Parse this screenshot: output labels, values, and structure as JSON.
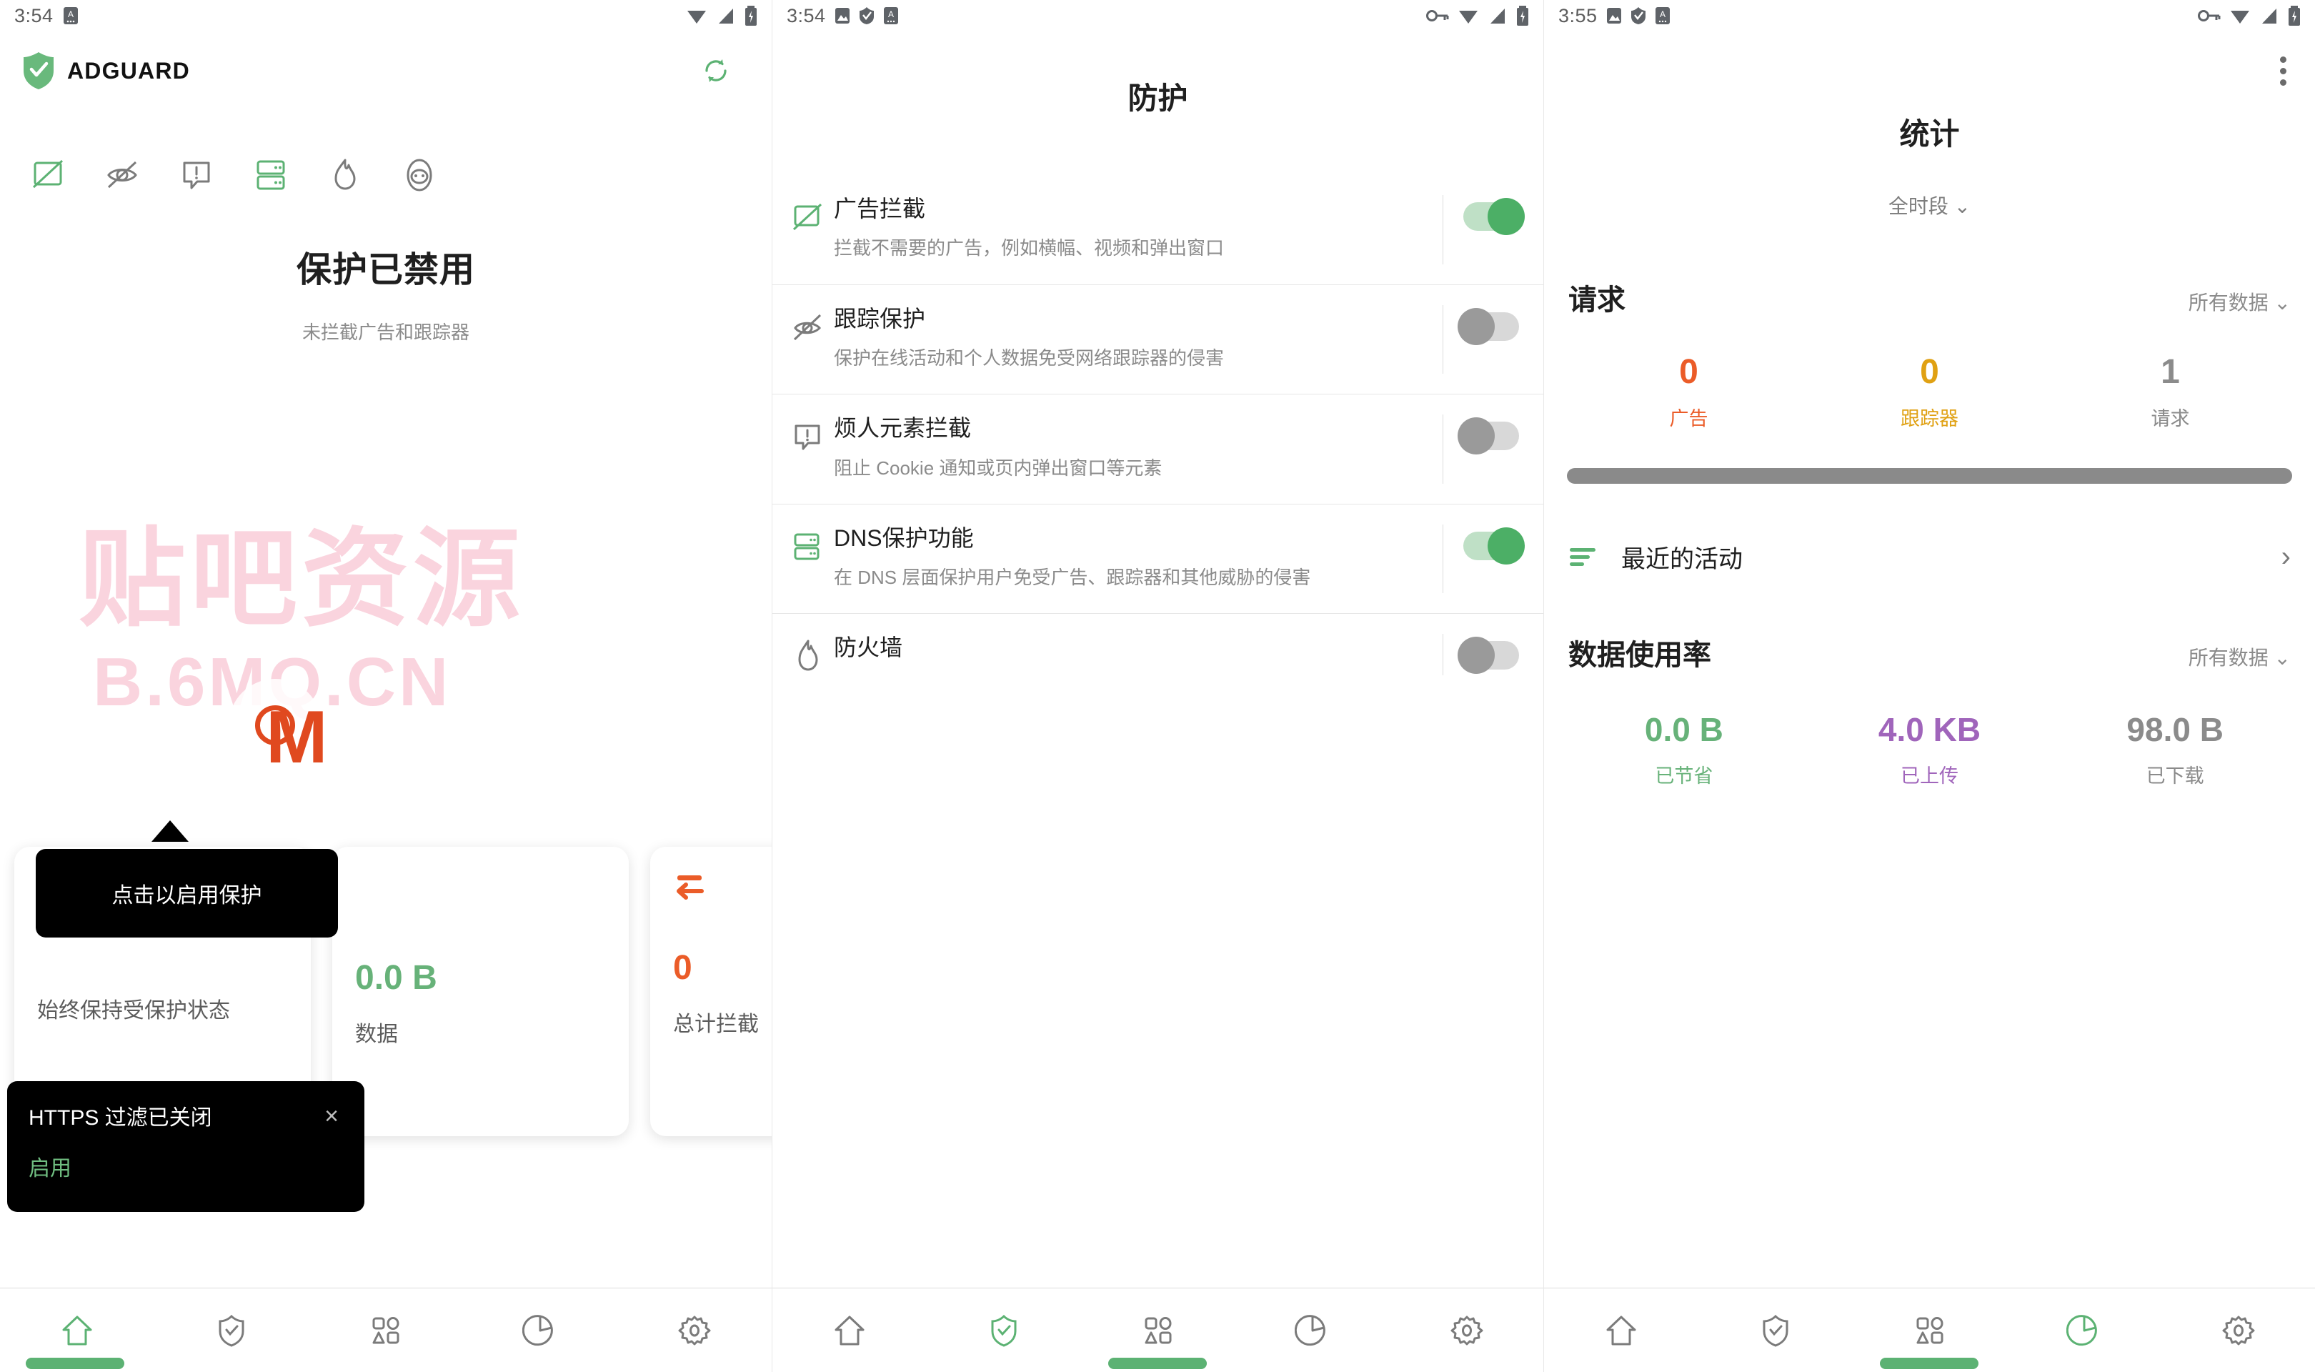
{
  "screens": [
    {
      "statusbar": {
        "time": "3:54",
        "icons": [
          "adguard-status-icon"
        ],
        "right_icons": [
          "wifi-icon",
          "signal-icon",
          "battery-charging-icon"
        ]
      },
      "appbar": {
        "brand": "ADGUARD",
        "refresh": "refresh-icon"
      },
      "protection": {
        "title": "保护已禁用",
        "subtitle": "未拦截广告和跟踪器",
        "icons": [
          "ad-blocking-icon",
          "tracking-protection-icon",
          "annoyance-icon",
          "dns-icon",
          "firewall-icon",
          "browsing-security-icon"
        ]
      },
      "watermark": {
        "line1": "贴吧资源",
        "line2": "B.6MQ.CN",
        "badge": "M"
      },
      "cards": [
        {
          "value": "",
          "label": "始终保持受保护状态"
        },
        {
          "value": "0.0 B",
          "label": "数据"
        },
        {
          "value": "0",
          "label": "总计拦截"
        }
      ],
      "tooltip": {
        "text": "点击以启用保护"
      },
      "snackbar": {
        "title": "HTTPS 过滤已关闭",
        "action": "启用",
        "close": "×"
      },
      "nav": [
        "home-icon",
        "shield-check-icon",
        "apps-icon",
        "pie-chart-icon",
        "gear-icon"
      ],
      "nav_active_index": 0
    },
    {
      "statusbar": {
        "time": "3:54",
        "right_icons": [
          "key-icon",
          "wifi-icon",
          "signal-icon",
          "battery-charging-icon"
        ]
      },
      "title": "防护",
      "items": [
        {
          "icon": "ad-blocking-icon",
          "name": "广告拦截",
          "desc": "拦截不需要的广告，例如横幅、视频和弹出窗口",
          "enabled": true
        },
        {
          "icon": "tracking-protection-icon",
          "name": "跟踪保护",
          "desc": "保护在线活动和个人数据免受网络跟踪器的侵害",
          "enabled": false
        },
        {
          "icon": "annoyance-icon",
          "name": "烦人元素拦截",
          "desc": "阻止 Cookie 通知或页内弹出窗口等元素",
          "enabled": false
        },
        {
          "icon": "dns-icon",
          "name": "DNS保护功能",
          "desc": "在 DNS 层面保护用户免受广告、跟踪器和其他威胁的侵害",
          "enabled": true
        },
        {
          "icon": "firewall-icon",
          "name": "防火墙",
          "desc": "",
          "enabled": false
        }
      ],
      "nav": [
        "home-icon",
        "shield-check-icon",
        "apps-icon",
        "pie-chart-icon",
        "gear-icon"
      ],
      "nav_active_index": 1
    },
    {
      "statusbar": {
        "time": "3:55",
        "right_icons": [
          "key-icon",
          "wifi-icon",
          "signal-icon",
          "battery-charging-icon"
        ]
      },
      "title": "统计",
      "period_filter": "全时段",
      "requests": {
        "heading": "请求",
        "filter": "所有数据",
        "stats": [
          {
            "value": "0",
            "label": "广告",
            "color": "#eb5c28"
          },
          {
            "value": "0",
            "label": "跟踪器",
            "color": "#e0a113"
          },
          {
            "value": "1",
            "label": "请求",
            "color": "#8b8b8b"
          }
        ]
      },
      "recent_activity": {
        "label": "最近的活动",
        "chevron": "›"
      },
      "usage": {
        "heading": "数据使用率",
        "filter": "所有数据",
        "stats": [
          {
            "value": "0.0 B",
            "label": "已节省",
            "color": "#67b279"
          },
          {
            "value": "4.0 KB",
            "label": "已上传",
            "color": "#a065bb"
          },
          {
            "value": "98.0 B",
            "label": "已下载",
            "color": "#8b8b8b"
          }
        ]
      },
      "nav": [
        "home-icon",
        "shield-check-icon",
        "apps-icon",
        "pie-chart-icon",
        "gear-icon"
      ],
      "nav_active_index": 3
    }
  ],
  "colors": {
    "brand_green": "#67b279",
    "accent_orange": "#eb5c28",
    "accent_yellow": "#e0a113",
    "accent_purple": "#a065bb",
    "grey": "#8b8b8b"
  }
}
